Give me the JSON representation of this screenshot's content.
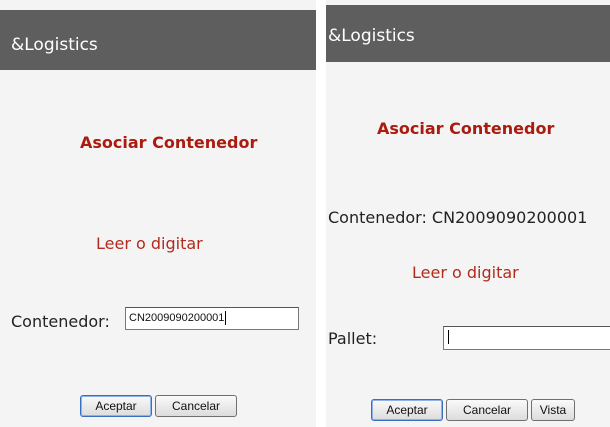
{
  "left": {
    "header": "&Logistics",
    "title": "Asociar Contenedor",
    "prompt": "Leer o digitar",
    "field_label": "Contenedor:",
    "field_value": "CN2009090200001",
    "accept_label": "Aceptar",
    "cancel_label": "Cancelar"
  },
  "right": {
    "header": "&Logistics",
    "title": "Asociar Contenedor",
    "container_info": "Contenedor: CN2009090200001",
    "prompt": "Leer o digitar",
    "field_label": "Pallet:",
    "field_value": "",
    "accept_label": "Aceptar",
    "cancel_label": "Cancelar",
    "view_label": "Vista"
  }
}
